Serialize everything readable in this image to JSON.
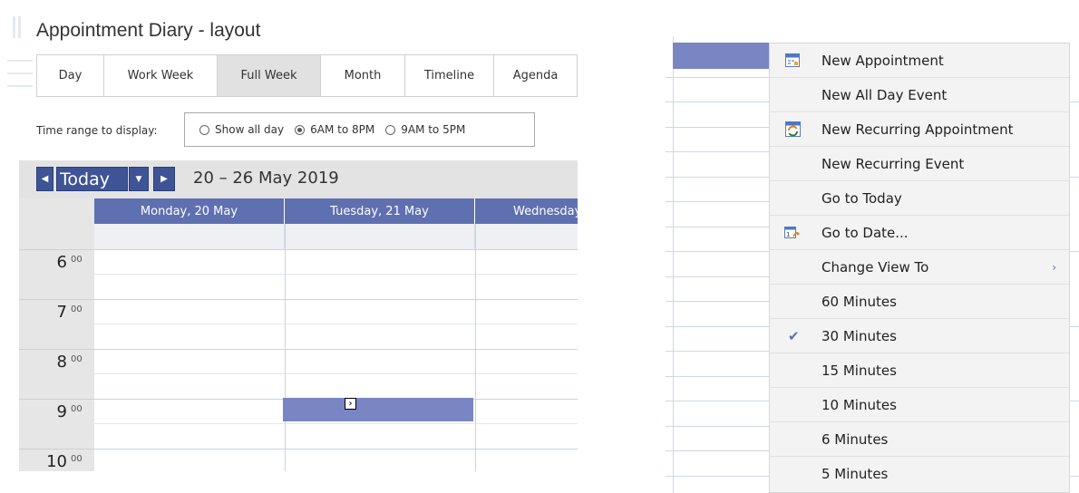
{
  "header": {
    "title": "Appointment Diary - layout"
  },
  "views": {
    "tabs": [
      {
        "label": "Day",
        "active": false
      },
      {
        "label": "Work Week",
        "active": false
      },
      {
        "label": "Full Week",
        "active": true
      },
      {
        "label": "Month",
        "active": false
      },
      {
        "label": "Timeline",
        "active": false
      },
      {
        "label": "Agenda",
        "active": false
      }
    ]
  },
  "time_range": {
    "label": "Time range to display:",
    "options": [
      {
        "label": "Show all day",
        "selected": false
      },
      {
        "label": "6AM to 8PM",
        "selected": true
      },
      {
        "label": "9AM to 5PM",
        "selected": false
      }
    ]
  },
  "navigator": {
    "today_label": "Today",
    "prev_icon": "arrow-left-icon",
    "next_icon": "arrow-right-icon",
    "dropdown_icon": "caret-down-icon",
    "date_range": "20 – 26 May 2019"
  },
  "calendar": {
    "days": [
      "Monday, 20 May",
      "Tuesday, 21 May",
      "Wednesday"
    ],
    "hours": [
      {
        "hour": "6",
        "min": "00"
      },
      {
        "hour": "7",
        "min": "00"
      },
      {
        "hour": "8",
        "min": "00"
      },
      {
        "hour": "9",
        "min": "00"
      },
      {
        "hour": "10",
        "min": "00"
      }
    ],
    "selection_color": "#7a85c4",
    "header_color": "#5f70b0"
  },
  "context_menu": {
    "items": [
      {
        "label": "New Appointment",
        "icon": "new-appointment-icon"
      },
      {
        "label": "New All Day Event"
      },
      {
        "label": "New Recurring Appointment",
        "icon": "recurring-appointment-icon"
      },
      {
        "label": "New Recurring Event"
      },
      {
        "label": "Go to Today"
      },
      {
        "label": "Go to Date...",
        "icon": "go-to-date-icon"
      },
      {
        "label": "Change View To",
        "submenu": true,
        "submenu_icon": "chevron-right-icon"
      },
      {
        "label": "60 Minutes"
      },
      {
        "label": "30 Minutes",
        "checked": true,
        "check_icon": "checkmark-icon"
      },
      {
        "label": "15 Minutes"
      },
      {
        "label": "10 Minutes"
      },
      {
        "label": "6 Minutes"
      },
      {
        "label": "5 Minutes"
      }
    ]
  }
}
